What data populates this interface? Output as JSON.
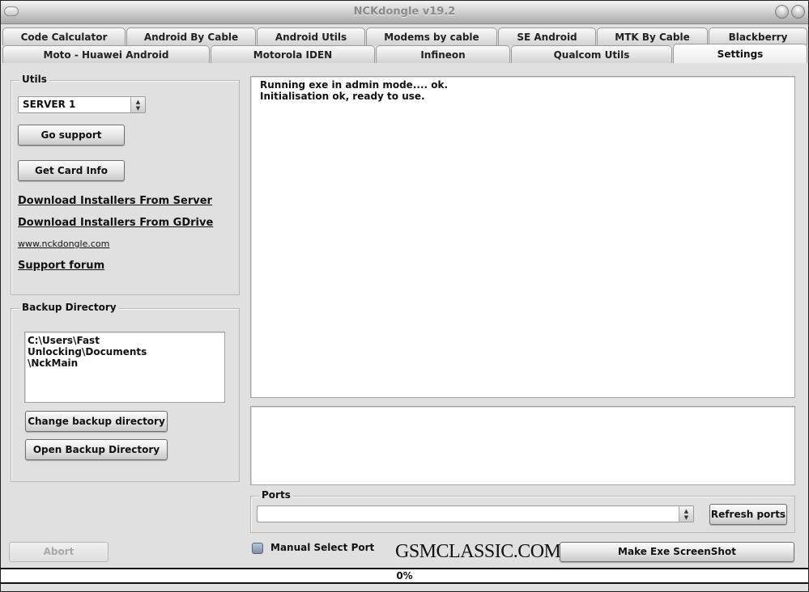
{
  "window": {
    "title": "NCKdongle v19.2",
    "left_button_icon": "menu-pill-icon",
    "right_buttons": [
      "minimize-icon",
      "close-icon"
    ]
  },
  "tabs": {
    "row1": [
      {
        "label": "Code Calculator"
      },
      {
        "label": "Android By Cable"
      },
      {
        "label": "Android Utils"
      },
      {
        "label": "Modems by cable"
      },
      {
        "label": "SE Android"
      },
      {
        "label": "MTK By Cable"
      },
      {
        "label": "Blackberry"
      }
    ],
    "row2": [
      {
        "label": "Moto - Huawei Android"
      },
      {
        "label": "Motorola IDEN"
      },
      {
        "label": "Infineon"
      },
      {
        "label": "Qualcom Utils"
      },
      {
        "label": "Settings",
        "active": true
      }
    ]
  },
  "utils": {
    "label": "Utils",
    "server_select": {
      "value": "SERVER 1"
    },
    "go_support": "Go support",
    "get_card_info": "Get Card Info",
    "links": {
      "download_server": "Download Installers From Server",
      "download_gdrive": "Download Installers From GDrive",
      "website": "www.nckdongle.com",
      "support_forum": "Support forum"
    }
  },
  "backup": {
    "label": "Backup Directory",
    "path_line1": "C:\\Users\\Fast Unlocking\\Documents",
    "path_line2": "\\NckMain",
    "change_button": "Change backup directory",
    "open_button": "Open Backup Directory"
  },
  "log": {
    "lines": [
      "Running exe in admin mode.... ok.",
      "Initialisation ok, ready to use."
    ]
  },
  "ports": {
    "label": "Ports",
    "selected": "",
    "refresh_button": "Refresh ports"
  },
  "bottom": {
    "abort_button": "Abort",
    "manual_select_port": "Manual Select Port",
    "manual_select_checked": false,
    "watermark": "GSMCLASSIC.COM",
    "screenshot_button": "Make Exe ScreenShot"
  },
  "progress": {
    "value_percent": 0,
    "label": "0%"
  }
}
